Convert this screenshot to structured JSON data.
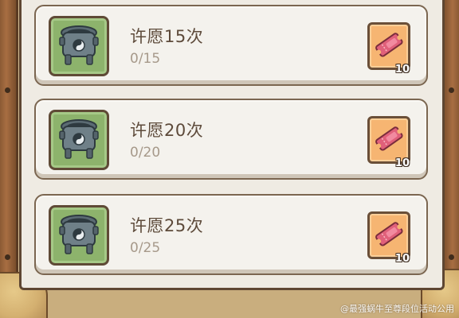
{
  "quests": [
    {
      "title": "许愿15次",
      "progress": "0/15",
      "reward_icon": "ticket-icon",
      "reward_count": "10"
    },
    {
      "title": "许愿20次",
      "progress": "0/20",
      "reward_icon": "ticket-icon",
      "reward_count": "10"
    },
    {
      "title": "许愿25次",
      "progress": "0/25",
      "reward_icon": "ticket-icon",
      "reward_count": "10"
    }
  ],
  "watermark": "@最强蜗牛至尊段位活动公用",
  "colors": {
    "panel_bg": "#efebe3",
    "thumb_bg": "#8db36c",
    "reward_bg": "#f6b572",
    "ticket": "#e0607a",
    "title_text": "#5d4a3a",
    "progress_text": "#a6998a"
  }
}
